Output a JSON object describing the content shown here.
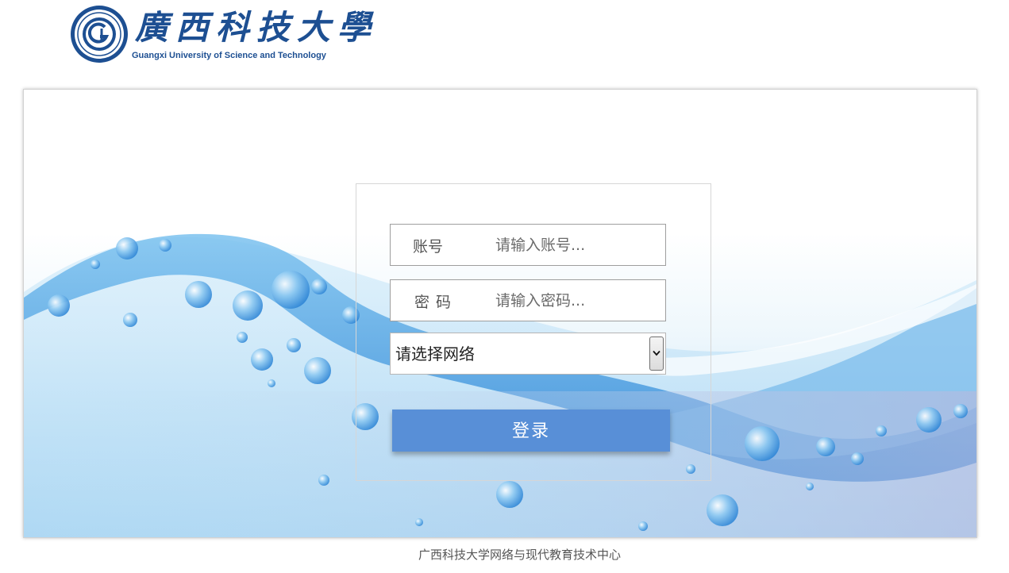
{
  "header": {
    "logo_name_cn": "廣西科技大學",
    "logo_name_en": "Guangxi University of  Science and Technology",
    "seal_icon": "university-seal-icon",
    "brand_color": "#1d4f92"
  },
  "login": {
    "username_label": "账号",
    "username_placeholder": "请输入账号...",
    "username_value": "",
    "password_label": "密码",
    "password_placeholder": "请输入密码...",
    "password_value": "",
    "network_select_value": "请选择网络",
    "select_arrow_icon": "chevron-down-icon",
    "submit_label": "登录",
    "button_color": "#588fd7"
  },
  "background": {
    "image": "water-splash-bubbles"
  },
  "footer": {
    "text": "广西科技大学网络与现代教育技术中心"
  }
}
